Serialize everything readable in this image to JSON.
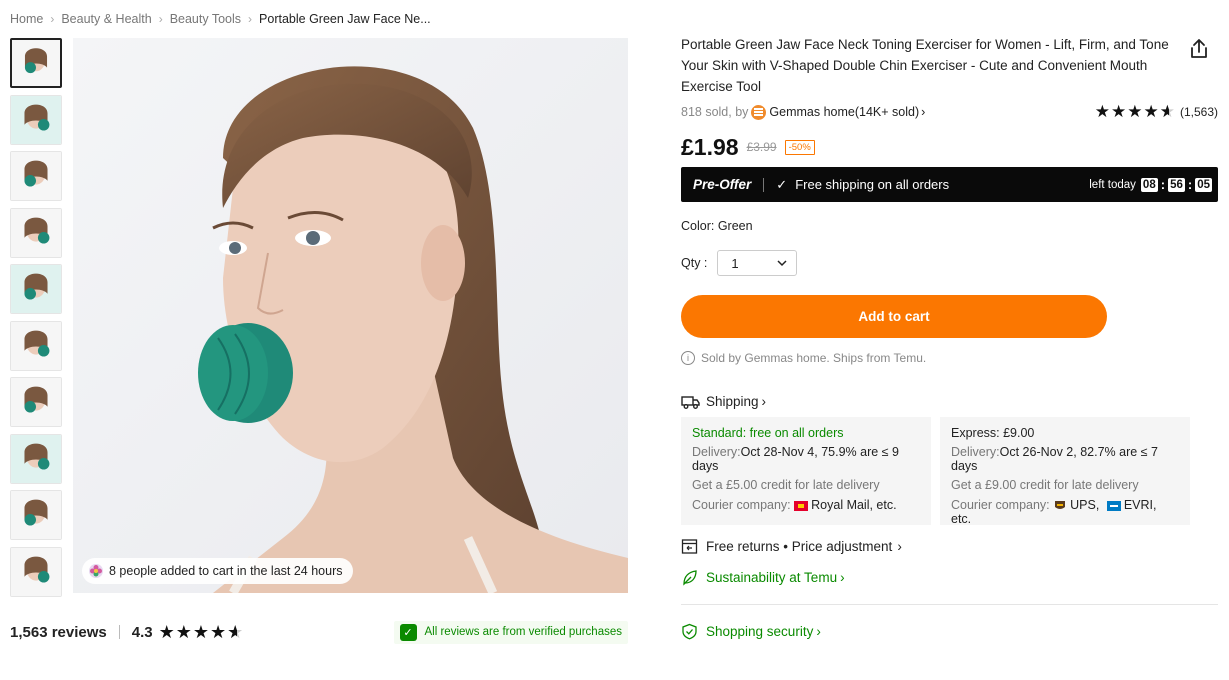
{
  "breadcrumb": [
    "Home",
    "Beauty & Health",
    "Beauty Tools",
    "Portable Green Jaw Face Ne..."
  ],
  "gallery": {
    "thumbnail_count": 10,
    "cart_notice": "8 people added to cart in the last 24 hours"
  },
  "reviews": {
    "count_label": "1,563 reviews",
    "rating": "4.3",
    "stars": 4.3,
    "verified_text": "All reviews are from verified purchases"
  },
  "product": {
    "title": "Portable Green Jaw Face Neck Toning Exerciser for Women - Lift, Firm, and Tone Your Skin with V-Shaped Double Chin Exerciser - Cute and Convenient Mouth Exercise Tool",
    "sold_prefix": "818 sold, by",
    "store": "Gemmas home(14K+ sold)",
    "rating_count": "(1,563)",
    "price": "£1.98",
    "old_price": "£3.99",
    "discount": "-50%"
  },
  "offer": {
    "label": "Pre-Offer",
    "shipping": "Free shipping on all orders",
    "left_today": "left today",
    "timer": [
      "08",
      "56",
      "05"
    ]
  },
  "color": "Color: Green",
  "qty": {
    "label": "Qty :",
    "value": "1"
  },
  "add_to_cart": "Add to cart",
  "sold_by": "Sold by Gemmas home. Ships from Temu.",
  "shipping": {
    "heading": "Shipping",
    "standard": {
      "title": "Standard: free on all orders",
      "delivery_label": "Delivery:",
      "delivery_value": "Oct 28-Nov 4, 75.9% are ≤ 9 days",
      "credit": "Get a £5.00 credit for late delivery",
      "courier_label": "Courier company:",
      "courier_value": "Royal Mail, etc."
    },
    "express": {
      "title": "Express: £9.00",
      "delivery_label": "Delivery:",
      "delivery_value": "Oct 26-Nov 2, 82.7% are ≤ 7 days",
      "credit": "Get a £9.00 credit for late delivery",
      "courier_label": "Courier company:",
      "courier_value_1": "UPS,",
      "courier_value_2": "EVRI, etc."
    }
  },
  "features": {
    "returns": "Free returns • Price adjustment",
    "sustainability": "Sustainability at Temu",
    "security": "Shopping security"
  },
  "colors": {
    "accent": "#fb7701",
    "green": "#0a8a00",
    "product_teal": "#1f8a78"
  }
}
